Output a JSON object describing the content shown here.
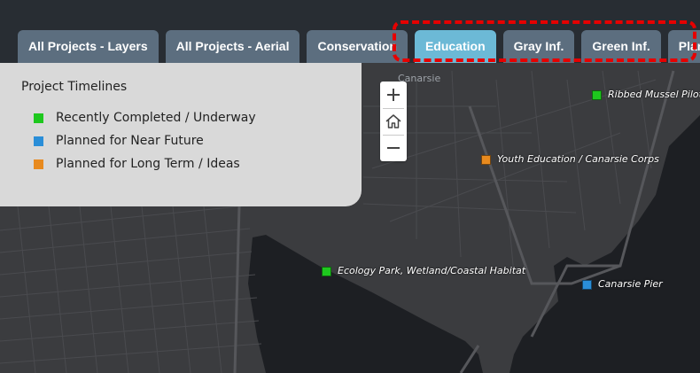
{
  "tabs": [
    {
      "label": "All Projects - Layers",
      "active": false
    },
    {
      "label": "All Projects - Aerial",
      "active": false
    },
    {
      "label": "Conservation",
      "active": false
    },
    {
      "label": "Education",
      "active": true
    },
    {
      "label": "Gray Inf.",
      "active": false
    },
    {
      "label": "Green Inf.",
      "active": false
    },
    {
      "label": "Plannin",
      "active": false
    }
  ],
  "legend": {
    "title": "Project Timelines",
    "items": [
      {
        "label": "Recently Completed / Underway",
        "color": "#1ec81e"
      },
      {
        "label": "Planned for Near Future",
        "color": "#2a8ed8"
      },
      {
        "label": "Planned for Long Term / Ideas",
        "color": "#e88a1e"
      }
    ]
  },
  "map": {
    "place_label": "Canarsie",
    "markers": [
      {
        "label": "Ribbed Mussel Pilot",
        "color": "#1ec81e"
      },
      {
        "label": "Youth Education / Canarsie Corps",
        "color": "#e88a1e"
      },
      {
        "label": "Ecology Park, Wetland/Coastal Habitat",
        "color": "#1ec81e"
      },
      {
        "label": "Canarsie Pier",
        "color": "#2a8ed8"
      }
    ]
  },
  "colors": {
    "highlight": "#e60000",
    "tab": "#5c6e7f",
    "tab_active": "#6cb9d6",
    "water": "#1d1f23",
    "land": "#3b3c3f"
  },
  "icons": {
    "zoom_in": "plus-icon",
    "home": "home-icon",
    "zoom_out": "minus-icon"
  }
}
